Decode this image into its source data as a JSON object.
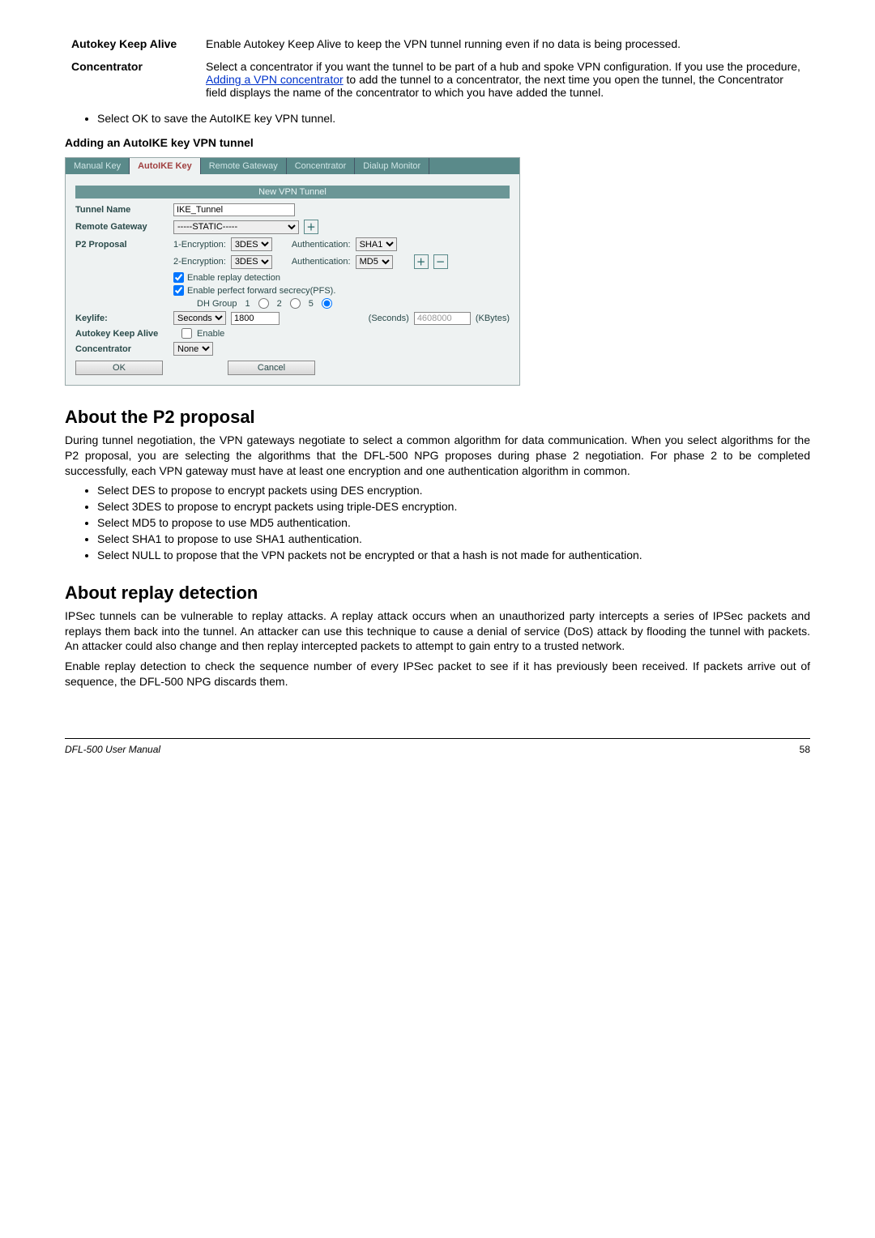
{
  "definitions": [
    {
      "label": "Autokey Keep Alive",
      "text": "Enable Autokey Keep Alive to keep the VPN tunnel running even if no data is being processed."
    },
    {
      "label": "Concentrator",
      "text_before_link": "Select a concentrator if you want the tunnel to be part of a hub and spoke VPN configuration. If you use the procedure, ",
      "link": "Adding a VPN concentrator",
      "text_after_link": " to add the tunnel to a concentrator, the next time you open the tunnel, the Concentrator field displays the name of the concentrator to which you have added the tunnel."
    }
  ],
  "save_bullet": "Select OK to save the AutoIKE key VPN tunnel.",
  "figure_caption": "Adding an AutoIKE key VPN tunnel",
  "screenshot": {
    "tabs": [
      "Manual Key",
      "AutoIKE Key",
      "Remote Gateway",
      "Concentrator",
      "Dialup Monitor"
    ],
    "active_tab_index": 1,
    "panel_title": "New VPN Tunnel",
    "tunnel_name_label": "Tunnel Name",
    "tunnel_name_value": "IKE_Tunnel",
    "remote_gateway_label": "Remote Gateway",
    "remote_gateway_value": "-----STATIC-----",
    "p2_label": "P2 Proposal",
    "enc_label_1": "1-Encryption:",
    "enc_value_1": "3DES",
    "auth_label_1": "Authentication:",
    "auth_value_1": "SHA1",
    "enc_label_2": "2-Encryption:",
    "enc_value_2": "3DES",
    "auth_label_2": "Authentication:",
    "auth_value_2": "MD5",
    "add_icon": "＋",
    "remove_icon": "－",
    "replay_label": "Enable replay detection",
    "pfs_label": "Enable perfect forward secrecy(PFS).",
    "dh_group_label": "DH Group",
    "dh_options": [
      "1",
      "2",
      "5"
    ],
    "dh_selected": "5",
    "keylife_label": "Keylife:",
    "keylife_unit": "Seconds",
    "keylife_seconds_value": "1800",
    "keylife_seconds_suffix": "(Seconds)",
    "keylife_kbytes_value": "4608000",
    "keylife_kbytes_suffix": "(KBytes)",
    "autokey_label": "Autokey Keep Alive",
    "autokey_enable": "Enable",
    "concentrator_label": "Concentrator",
    "concentrator_value": "None",
    "ok_btn": "OK",
    "cancel_btn": "Cancel"
  },
  "section1": {
    "title": "About the P2 proposal",
    "para": "During tunnel negotiation, the VPN gateways negotiate to select a common algorithm for data communication. When you select algorithms for the P2 proposal, you are selecting the algorithms that the DFL-500 NPG proposes during phase 2 negotiation. For phase 2 to be completed successfully, each VPN gateway must have at least one encryption and one authentication algorithm in common.",
    "bullets": [
      "Select DES to propose to encrypt packets using DES encryption.",
      "Select 3DES to propose to encrypt packets using triple-DES encryption.",
      "Select MD5 to propose to use MD5 authentication.",
      "Select SHA1 to propose to use SHA1 authentication.",
      "Select NULL to propose that the VPN packets not be encrypted or that a hash is not made for authentication."
    ]
  },
  "section2": {
    "title": "About replay detection",
    "para1": "IPSec tunnels can be vulnerable to replay attacks. A replay attack occurs when an unauthorized party intercepts a series of IPSec packets and replays them back into the tunnel. An attacker can use this technique to cause a denial of service (DoS) attack by flooding the tunnel with packets. An attacker could also change and then replay intercepted packets to attempt to gain entry to a trusted network.",
    "para2": "Enable replay detection to check the sequence number of every IPSec packet to see if it has previously been received. If packets arrive out of sequence, the DFL-500 NPG discards them."
  },
  "footer": {
    "left": "DFL-500 User Manual",
    "page": "58"
  }
}
